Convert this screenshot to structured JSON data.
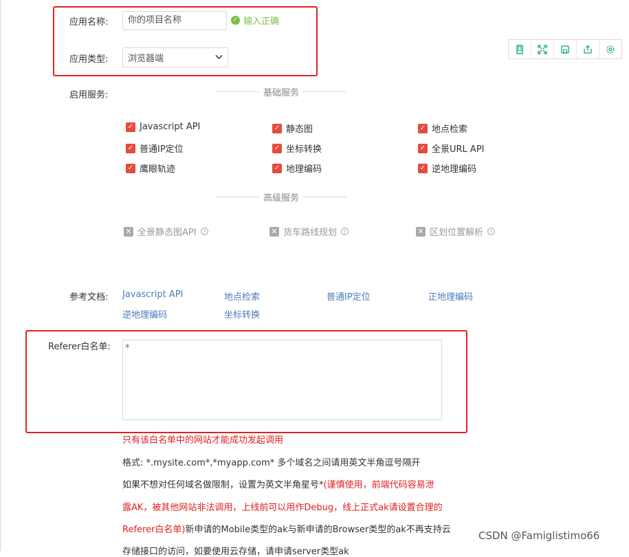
{
  "form": {
    "app_name_label": "应用名称:",
    "app_name_value": "你的项目名称",
    "app_name_status": "输入正确",
    "app_type_label": "应用类型:",
    "app_type_value": "浏览器端",
    "services_label": "启用服务:",
    "basic_services_title": "基础服务",
    "advanced_services_title": "高级服务",
    "basic_services": [
      "Javascript API",
      "静态图",
      "地点检索",
      "普通IP定位",
      "坐标转换",
      "全景URL API",
      "鹰眼轨迹",
      "地理编码",
      "逆地理编码"
    ],
    "advanced_services": [
      "全景静态图API",
      "货车路线规划",
      "区划位置解析"
    ],
    "docs_label": "参考文档:",
    "doc_links": [
      "Javascript API",
      "地点检索",
      "普通IP定位",
      "正地理编码",
      "逆地理编码",
      "坐标转换"
    ],
    "referer_label": "Referer白名单:",
    "referer_value": "*"
  },
  "notes": {
    "line1": "只有该白名单中的网站才能成功发起调用",
    "line2": "格式: *.mysite.com*,*myapp.com* 多个域名之间请用英文半角逗号隔开",
    "line3_a": "如果不想对任何域名做限制，设置为英文半角星号*",
    "line3_b": "(谨慎使用，前端代码容易泄",
    "line4": "露AK，被其他网站非法调用，上线前可以用作Debug，线上正式ak请设置合理的",
    "line5_a": "Referer白名单)",
    "line5_b": "新申请的Mobile类型的ak与新申请的Browser类型的ak不再支持云",
    "line6": "存储接口的访问，如要使用云存储，请申请server类型ak"
  },
  "watermark": "CSDN @Famiglistimo66",
  "colors": {
    "accent_red": "#e84a3c",
    "link_blue": "#4a7bbf",
    "ok_green": "#7ac143",
    "toolbar_teal": "#1aa37a"
  },
  "toolbar_icons": [
    "phone-icon",
    "expand-icon",
    "save-icon",
    "share-icon",
    "settings-icon"
  ]
}
